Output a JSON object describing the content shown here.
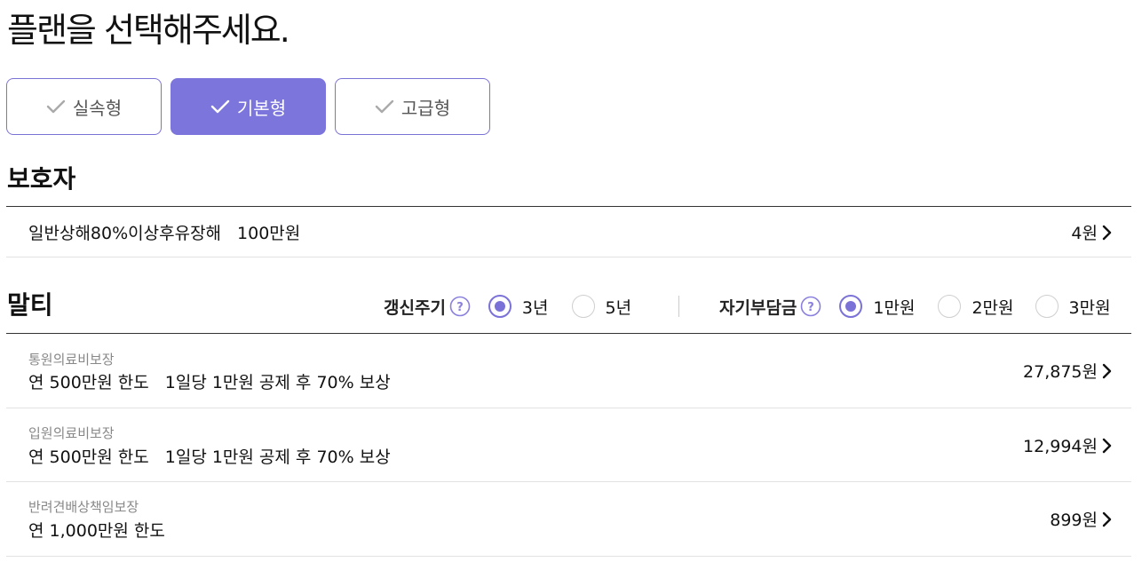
{
  "page_title": "플랜을 선택해주세요.",
  "plans": [
    {
      "label": "실속형",
      "active": false
    },
    {
      "label": "기본형",
      "active": true
    },
    {
      "label": "고급형",
      "active": false
    }
  ],
  "guardian": {
    "title": "보호자",
    "rows": [
      {
        "name": "일반상해80%이상후유장해",
        "amount": "100만원",
        "price": "4원"
      }
    ]
  },
  "malti": {
    "title": "말티",
    "renewal": {
      "label": "갱신주기",
      "options": [
        "3년",
        "5년"
      ],
      "selected": "3년"
    },
    "deductible": {
      "label": "자기부담금",
      "options": [
        "1만원",
        "2만원",
        "3만원"
      ],
      "selected": "1만원"
    },
    "rows": [
      {
        "sub": "통원의료비보장",
        "main": "연 500만원 한도",
        "detail": "1일당 1만원 공제 후 70% 보상",
        "price": "27,875원"
      },
      {
        "sub": "입원의료비보장",
        "main": "연 500만원 한도",
        "detail": "1일당 1만원 공제 후 70% 보상",
        "price": "12,994원"
      },
      {
        "sub": "반려견배상책임보장",
        "main": "연 1,000만원 한도",
        "detail": "",
        "price": "899원"
      }
    ]
  },
  "colors": {
    "accent": "#7b72d8",
    "active_tab": "#7b75dc",
    "muted_text": "#888888",
    "divider": "#e2e2e2"
  },
  "icons": {
    "check": "check-icon",
    "chevron": "chevron-right-icon",
    "help": "question-circle-icon"
  }
}
